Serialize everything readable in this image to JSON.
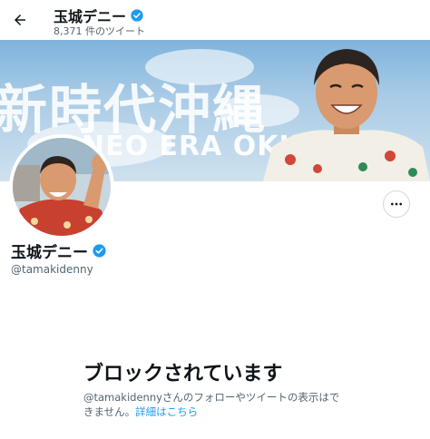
{
  "header": {
    "back_icon": "arrow-left-icon",
    "name": "玉城デニー",
    "verified_icon": "verified-badge-icon",
    "tweet_count": "8,371 件のツイート"
  },
  "banner": {
    "text_line_1": "新時代沖縄",
    "text_line_2": "NEO ERA OKINAWA"
  },
  "profile": {
    "name": "玉城デニー",
    "handle": "@tamakidenny",
    "more_icon": "more-dots-icon"
  },
  "blocked": {
    "title": "ブロックされています",
    "desc_line_1": "@tamakidennyさんのフォローやツイートの表示はで",
    "desc_line_2_prefix": "きません。",
    "link_text": "詳細はこちら"
  },
  "colors": {
    "accent": "#1d9bf0",
    "text_primary": "#0f1419",
    "text_secondary": "#536471",
    "verified": "#1d9bf0"
  }
}
